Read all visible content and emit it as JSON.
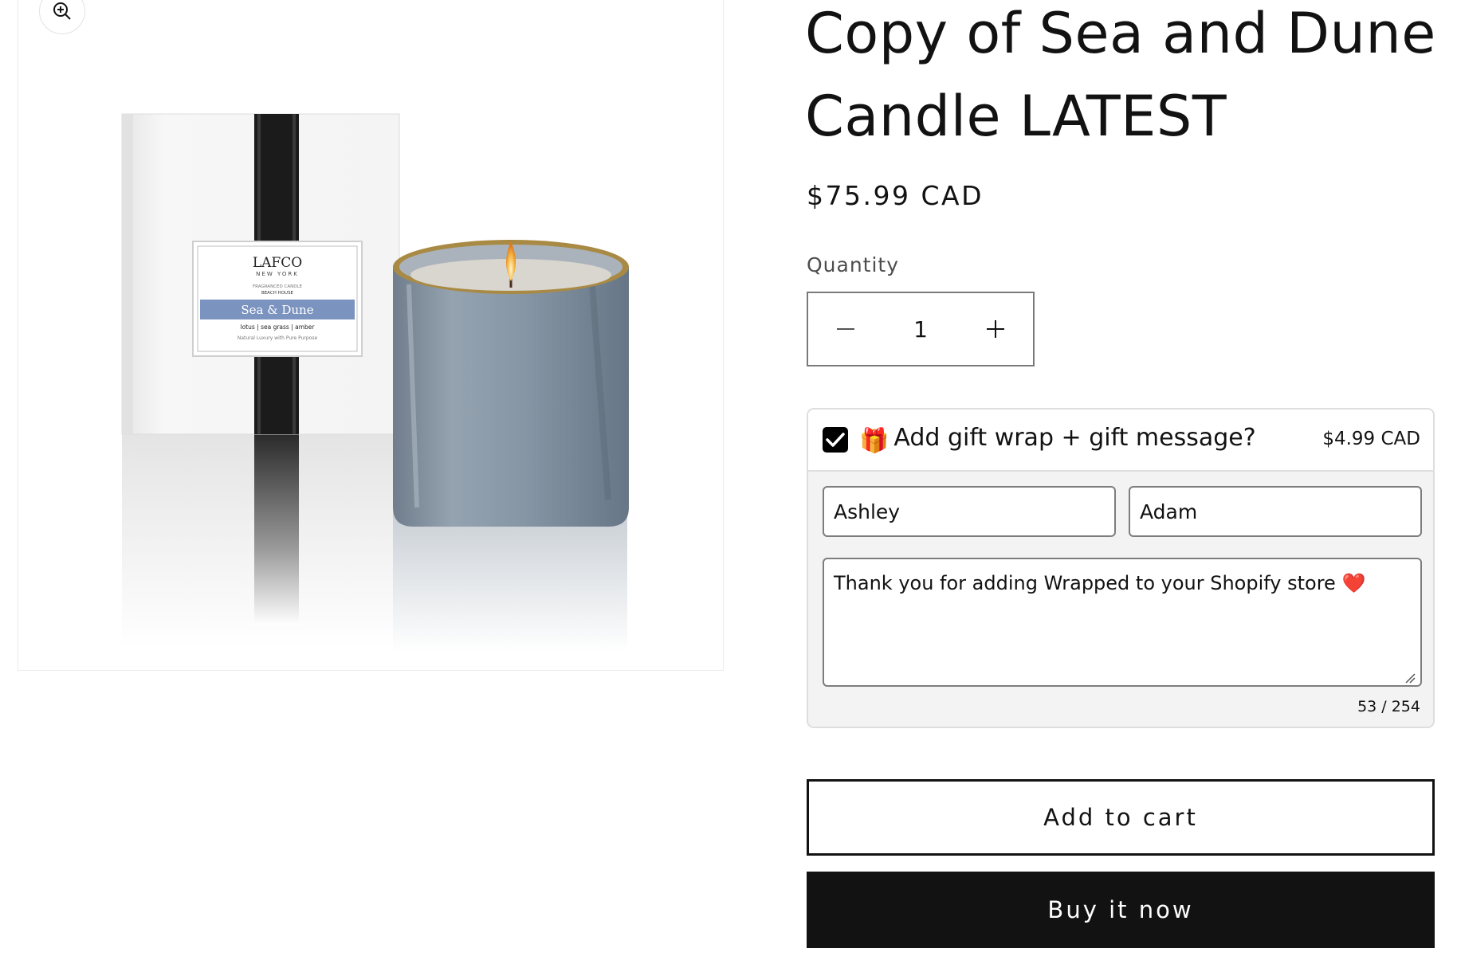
{
  "product": {
    "title": "Copy of Sea and Dune Candle LATEST",
    "price": "$75.99 CAD",
    "image": {
      "brand": "LAFCO",
      "brand_sub": "NEW YORK",
      "label_line1": "FRAGRANCED CANDLE",
      "label_line2": "BEACH HOUSE",
      "scent_name": "Sea & Dune",
      "notes": "lotus | sea grass | amber",
      "tagline": "Natural Luxury with Pure Purpose"
    }
  },
  "quantity": {
    "label": "Quantity",
    "value": "1"
  },
  "gift_wrap": {
    "checked": true,
    "emoji": "🎁",
    "label": "Add gift wrap + gift message?",
    "price": "$4.99 CAD",
    "to_value": "Ashley",
    "from_value": "Adam",
    "message": "Thank you for adding Wrapped to your Shopify store ❤️",
    "counter": "53 / 254"
  },
  "actions": {
    "add_to_cart": "Add to cart",
    "buy_now": "Buy it now"
  },
  "icons": {
    "zoom": "zoom-in-icon",
    "minus": "minus-icon",
    "plus": "plus-icon",
    "check": "checkmark-icon"
  }
}
